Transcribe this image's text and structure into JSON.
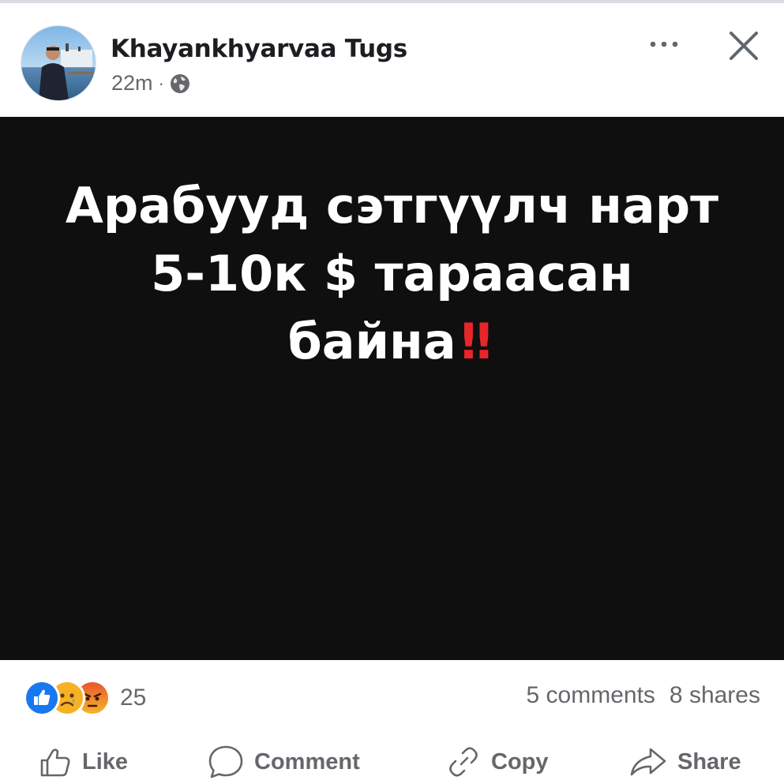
{
  "post": {
    "author": "Khayankhyarvaa Tugs",
    "time": "22m",
    "separator": "·",
    "audience_icon": "globe-icon",
    "text_lines": [
      "Арабууд сэтгүүлч нарт",
      "5-10к $ тараасан",
      "байна"
    ],
    "emphasis": "‼",
    "media_background": "#0f0f10"
  },
  "stats": {
    "reaction_icons": [
      "like-reaction-icon",
      "sad-reaction-icon",
      "angry-reaction-icon"
    ],
    "reaction_count": "25",
    "comments": "5 comments",
    "shares": "8 shares"
  },
  "actions": {
    "like": "Like",
    "comment": "Comment",
    "copy": "Copy",
    "share": "Share"
  },
  "colors": {
    "accent_blue": "#1877f2",
    "text_secondary": "#65676b",
    "emphasis_red": "#e6262b"
  }
}
